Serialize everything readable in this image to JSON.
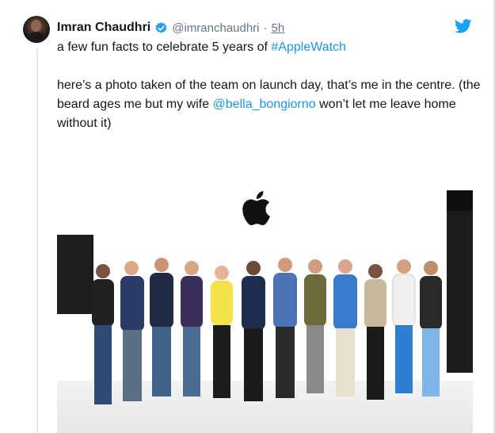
{
  "tweet": {
    "author_name": "Imran Chaudhri",
    "handle": "@imranchaudhri",
    "separator": "·",
    "time": "5h",
    "line1_text": "a few fun facts to celebrate 5 years of ",
    "line1_hashtag": "#AppleWatch",
    "para2_before": "here’s a photo taken of the team on launch day, that’s me in the centre. (the beard ages me but my wife ",
    "para2_mention": "@bella_bongiorno",
    "para2_after": " won’t let me leave home without it)"
  },
  "colors": {
    "link": "#1b95e0",
    "secondary_text": "#657786",
    "verified_badge": "#1da1f2",
    "twitter_bird": "#1da1f2"
  },
  "icons": {
    "verified": "verified-badge-icon",
    "brand": "twitter-bird-icon",
    "photo_logo": "apple-logo-icon"
  }
}
